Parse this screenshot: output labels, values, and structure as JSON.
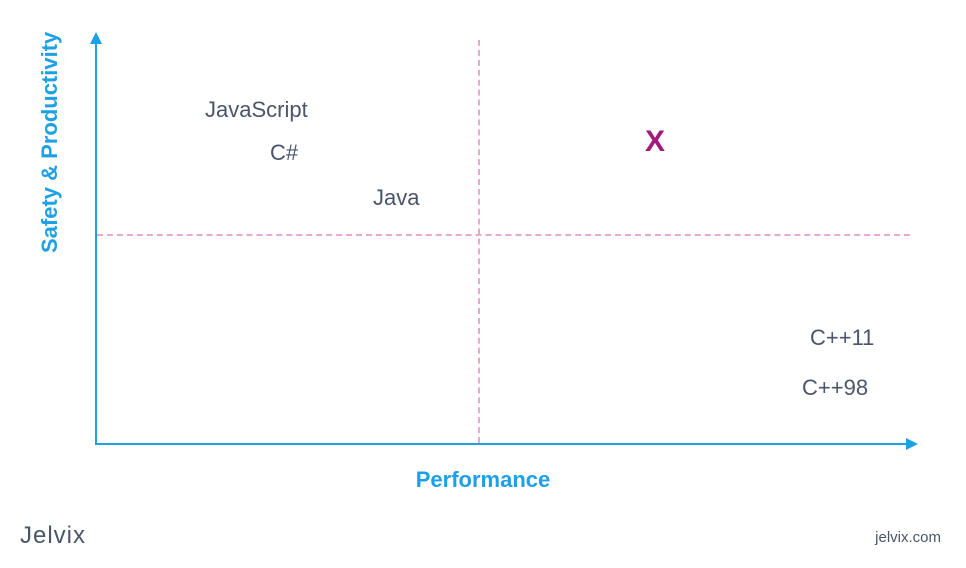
{
  "chart_data": {
    "type": "scatter",
    "xlabel": "Performance",
    "ylabel": "Safety & Productivity",
    "xlim": [
      0,
      100
    ],
    "ylim": [
      0,
      100
    ],
    "series": [
      {
        "name": "JavaScript",
        "x": 19,
        "y": 85
      },
      {
        "name": "C#",
        "x": 26,
        "y": 73
      },
      {
        "name": "Java",
        "x": 38,
        "y": 62
      },
      {
        "name": "C++11",
        "x": 92,
        "y": 27
      },
      {
        "name": "C++98",
        "x": 92,
        "y": 14
      }
    ],
    "markers": [
      {
        "label": "X",
        "x": 71,
        "y": 75
      }
    ],
    "gridlines": {
      "mid_horizontal": 52,
      "mid_vertical": 47
    }
  },
  "branding": {
    "logo": "Jelvix",
    "url": "jelvix.com"
  }
}
